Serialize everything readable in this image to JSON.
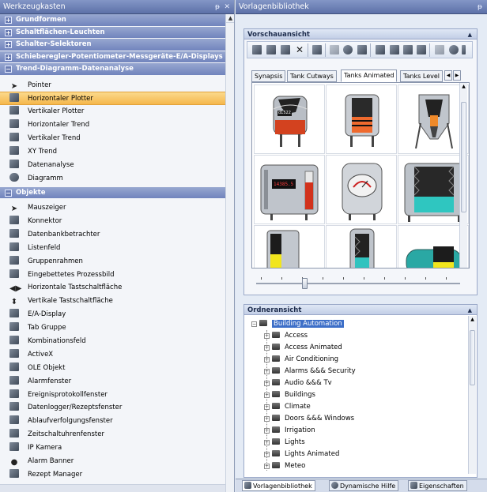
{
  "toolbox": {
    "title": "Werkzeugkasten",
    "pin_glyph": "ᵽ",
    "close_glyph": "✕",
    "categories_top": [
      {
        "label": "Grundformen",
        "state": "+"
      },
      {
        "label": "Schaltflächen-Leuchten",
        "state": "+"
      },
      {
        "label": "Schalter-Selektoren",
        "state": "+"
      },
      {
        "label": "Schieberegler-Potentiometer-Messgeräte-E/A-Displays",
        "state": "+"
      },
      {
        "label": "Trend-Diagramm-Datenanalyse",
        "state": "−"
      }
    ],
    "trend_items": [
      {
        "label": "Pointer",
        "icon": "pointer-arrow-icon"
      },
      {
        "label": "Horizontaler Plotter",
        "icon": "horizontal-plotter-icon",
        "selected": true
      },
      {
        "label": "Vertikaler Plotter",
        "icon": "vertical-plotter-icon"
      },
      {
        "label": "Horizontaler Trend",
        "icon": "horizontal-trend-icon"
      },
      {
        "label": "Vertikaler Trend",
        "icon": "vertical-trend-icon"
      },
      {
        "label": "XY Trend",
        "icon": "xy-trend-icon"
      },
      {
        "label": "Datenanalyse",
        "icon": "data-analysis-icon"
      },
      {
        "label": "Diagramm",
        "icon": "pie-chart-icon"
      }
    ],
    "objects_category": {
      "label": "Objekte",
      "state": "−"
    },
    "object_items": [
      {
        "label": "Mauszeiger",
        "icon": "mouse-pointer-icon"
      },
      {
        "label": "Konnektor",
        "icon": "connector-icon"
      },
      {
        "label": "Datenbankbetrachter",
        "icon": "database-viewer-icon"
      },
      {
        "label": "Listenfeld",
        "icon": "listbox-icon"
      },
      {
        "label": "Gruppenrahmen",
        "icon": "group-frame-icon"
      },
      {
        "label": "Eingebettetes Prozessbild",
        "icon": "embedded-screen-icon"
      },
      {
        "label": "Horizontale Tastschaltfläche",
        "icon": "horizontal-button-icon"
      },
      {
        "label": "Vertikale Tastschaltfläche",
        "icon": "vertical-button-icon"
      },
      {
        "label": "E/A-Display",
        "icon": "io-display-icon"
      },
      {
        "label": "Tab Gruppe",
        "icon": "tab-group-icon"
      },
      {
        "label": "Kombinationsfeld",
        "icon": "combobox-icon"
      },
      {
        "label": "ActiveX",
        "icon": "activex-icon"
      },
      {
        "label": "OLE Objekt",
        "icon": "ole-object-icon"
      },
      {
        "label": "Alarmfenster",
        "icon": "alarm-window-icon"
      },
      {
        "label": "Ereignisprotokollfenster",
        "icon": "event-log-icon"
      },
      {
        "label": "Datenlogger/Rezeptsfenster",
        "icon": "datalogger-icon"
      },
      {
        "label": "Ablaufverfolgungsfenster",
        "icon": "trace-window-icon"
      },
      {
        "label": "Zeitschaltuhrenfenster",
        "icon": "scheduler-icon"
      },
      {
        "label": "IP Kamera",
        "icon": "ip-camera-icon"
      },
      {
        "label": "Alarm Banner",
        "icon": "alarm-banner-icon"
      },
      {
        "label": "Rezept Manager",
        "icon": "recipe-manager-icon"
      }
    ]
  },
  "library": {
    "title": "Vorlagenbibliothek",
    "pin_glyph": "ᵽ",
    "preview_title": "Vorschauansicht",
    "tabs": [
      {
        "label": "Synapsis",
        "active": false
      },
      {
        "label": "Tank Cutways",
        "active": false
      },
      {
        "label": "Tanks Animated",
        "active": true
      },
      {
        "label": "Tanks Level",
        "active": false
      }
    ],
    "tank_labels": {
      "cell1": "d1522",
      "cell4": "14385.5"
    },
    "folder_title": "Ordneransicht",
    "tree_root": "Building Automation",
    "tree_items": [
      "Access",
      "Access Animated",
      "Air Conditioning",
      "Alarms &amp;& Security",
      "Audio &amp;& Tv",
      "Buildings",
      "Climate",
      "Doors &amp;& Windows",
      "Irrigation",
      "Lights",
      "Lights Animated",
      "Meteo"
    ],
    "tree_items_display": [
      "Access",
      "Access Animated",
      "Air Conditioning",
      "Alarms &&& Security",
      "Audio &&& Tv",
      "Buildings",
      "Climate",
      "Doors &&& Windows",
      "Irrigation",
      "Lights",
      "Lights Animated",
      "Meteo"
    ],
    "bottom_tabs": [
      {
        "label": "Vorlagenbibliothek",
        "active": true
      },
      {
        "label": "Dynamische Hilfe",
        "active": false
      },
      {
        "label": "Eigenschaften",
        "active": false
      }
    ]
  }
}
